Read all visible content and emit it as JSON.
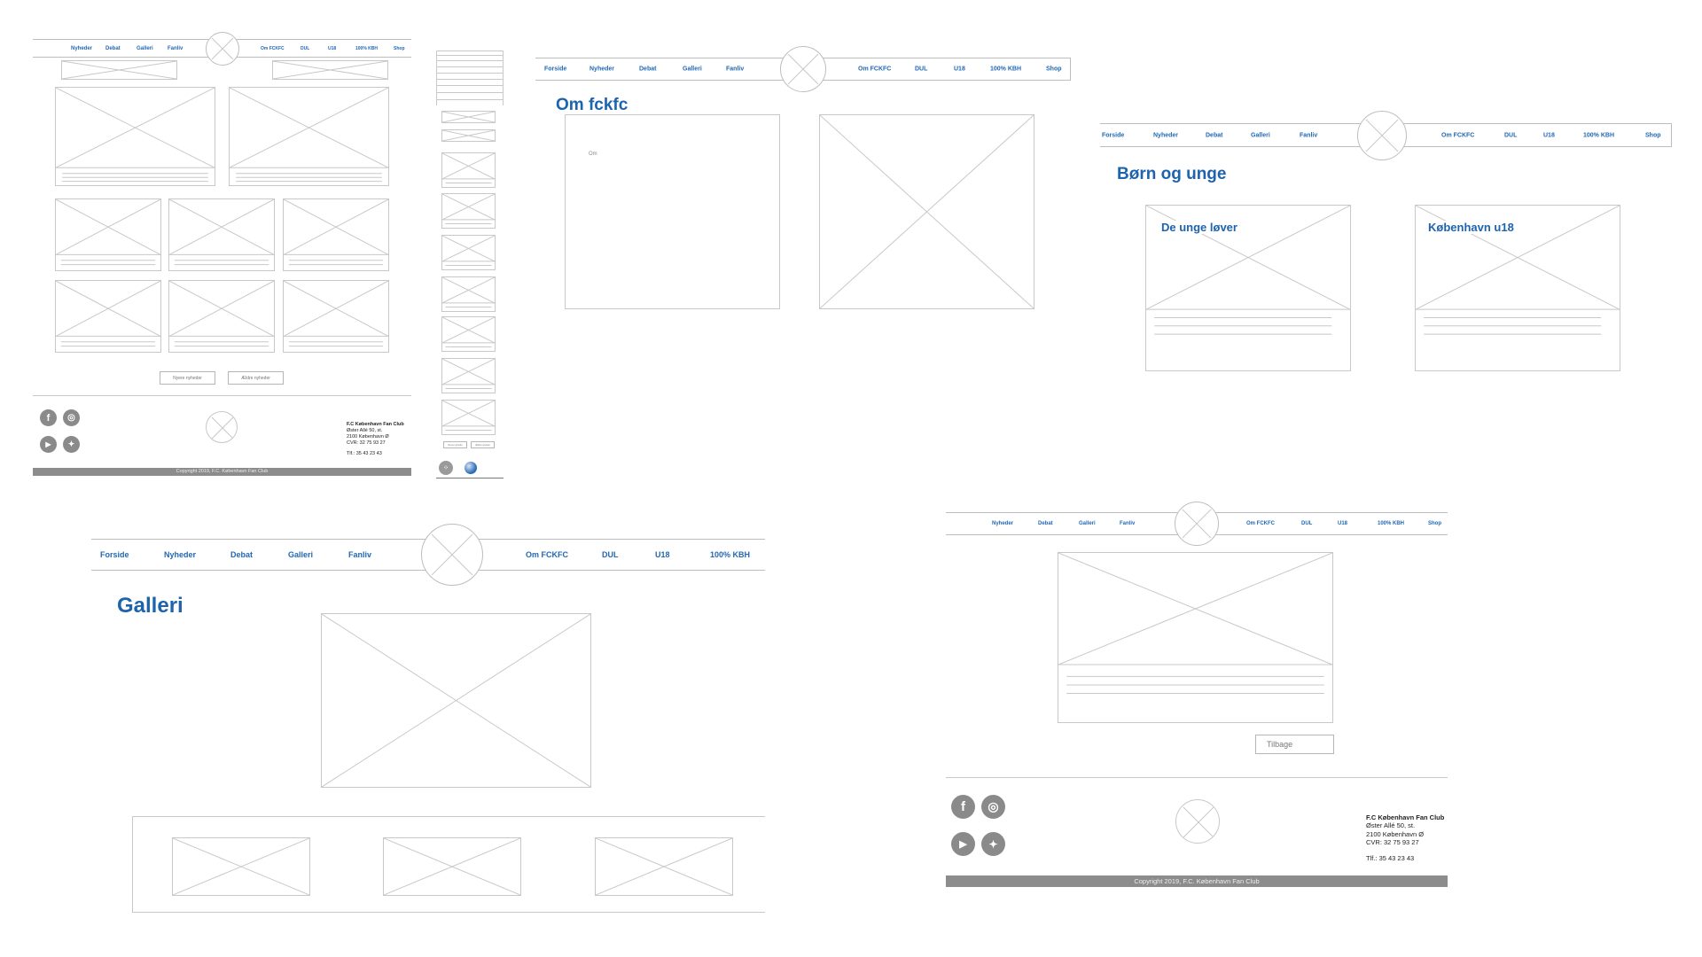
{
  "nav_main": [
    "Forside",
    "Nyheder",
    "Debat",
    "Galleri",
    "Fanliv"
  ],
  "nav_right": [
    "Om FCKFC",
    "DUL",
    "U18",
    "100% KBH",
    "Shop"
  ],
  "nav_homepage_left": [
    "Nyheder",
    "Debat",
    "Galleri",
    "Fanliv"
  ],
  "nav_homepage_right": [
    "Om FCKFC",
    "DUL",
    "U18",
    "100% KBH",
    "Shop"
  ],
  "nav_article_left": [
    "Nyheder",
    "Debat",
    "Galleri",
    "Fanliv"
  ],
  "nav_article_right": [
    "Om FCKFC",
    "DUL",
    "U18",
    "100% KBH",
    "Shop"
  ],
  "nav_gallery_right": [
    "Om FCKFC",
    "DUL",
    "U18",
    "100% KBH"
  ],
  "homepage": {
    "buttons": [
      "Nyere nyheder",
      "Ældre nyheder"
    ],
    "mobile_buttons": [
      "Nyere nyheder",
      "Ældre nyheder"
    ]
  },
  "om": {
    "title": "Om fckfc",
    "body_label": "Om"
  },
  "born": {
    "title": "Børn og unge",
    "card1": "De unge løver",
    "card2": "København u18"
  },
  "galleri": {
    "title": "Galleri"
  },
  "article": {
    "back_button": "Tilbage"
  },
  "footer": {
    "org": "F.C København Fan Club",
    "address1": "Øster Allé 50, st.",
    "address2": "2100 København Ø",
    "cvr": "CVR: 32 75 93 27",
    "phone": "Tlf.: 35 43 23 43",
    "copyright": "Copyright 2019, F.C. København Fan Club"
  },
  "icons": [
    "facebook-icon",
    "instagram-icon",
    "youtube-icon",
    "twitter-icon"
  ],
  "colors": {
    "accent": "#1d63ad",
    "wire": "#c8c8c8",
    "footer_bar": "#8c8c8c"
  }
}
